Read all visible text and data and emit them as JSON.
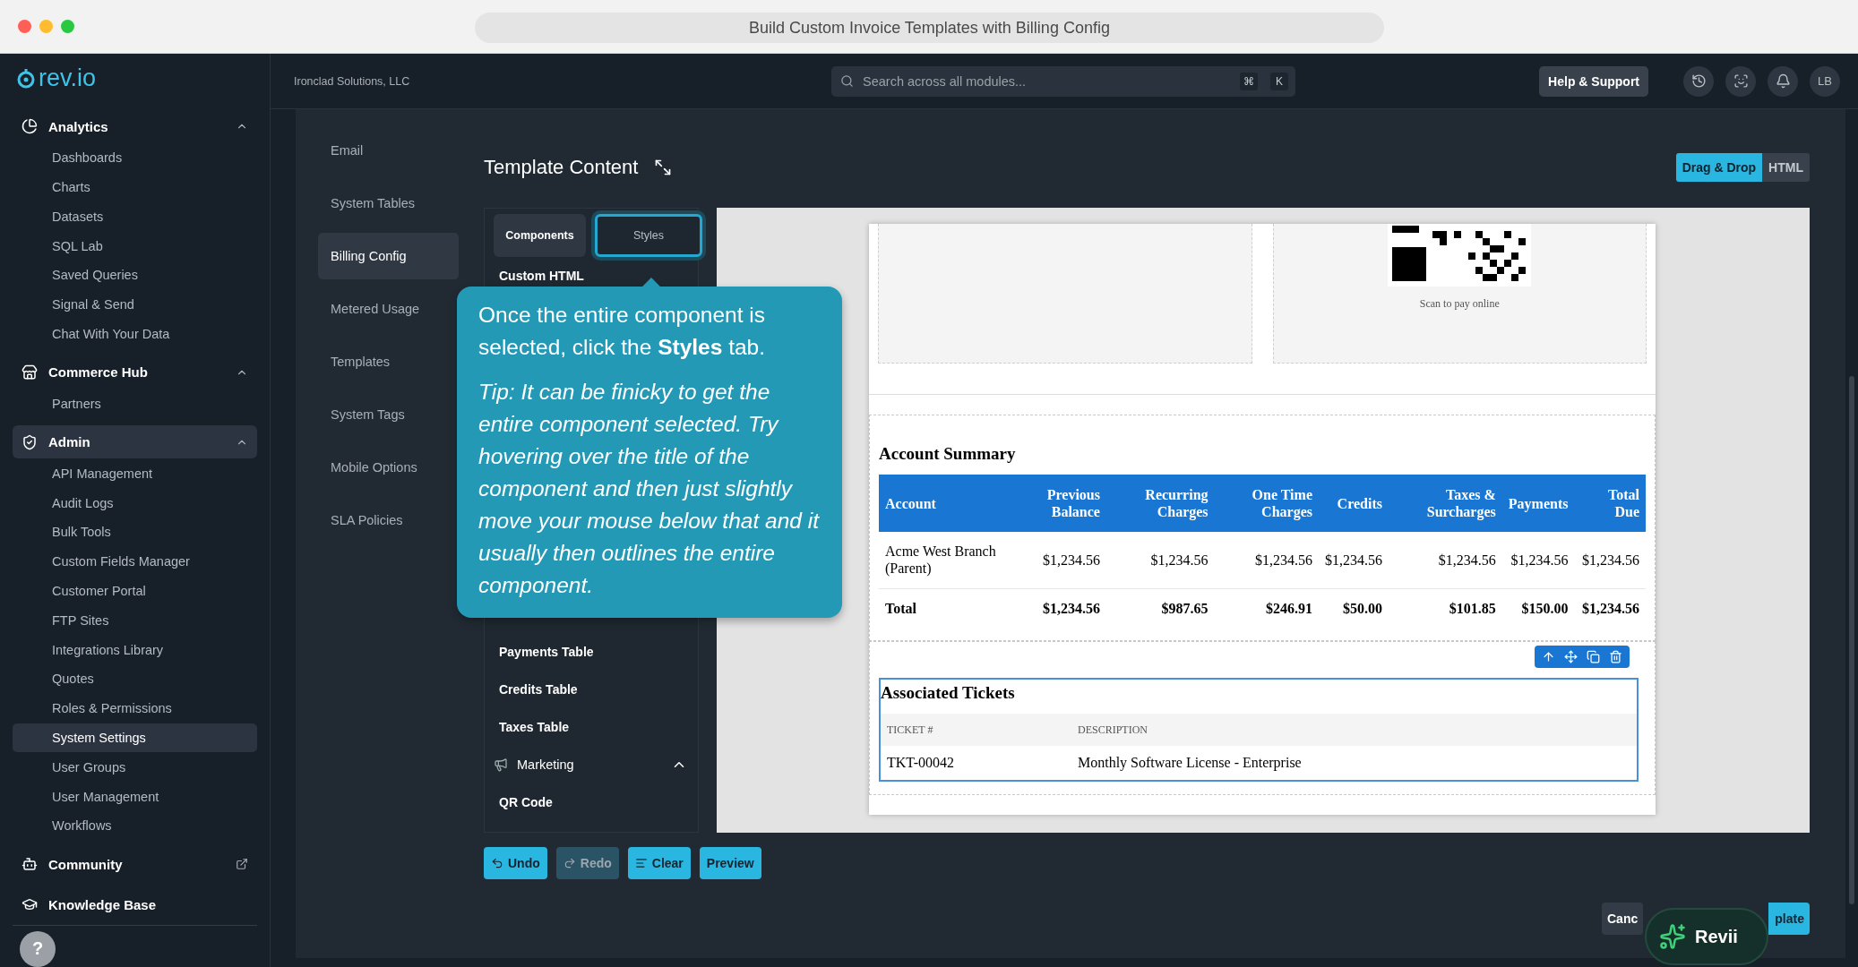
{
  "browser": {
    "title": "Build Custom Invoice Templates with Billing Config"
  },
  "sidebar": {
    "logo": "rev.io",
    "sections": [
      {
        "label": "Analytics",
        "expanded": true,
        "selected": false,
        "items": [
          {
            "label": "Dashboards",
            "selected": false
          },
          {
            "label": "Charts",
            "selected": false
          },
          {
            "label": "Datasets",
            "selected": false
          },
          {
            "label": "SQL Lab",
            "selected": false
          },
          {
            "label": "Saved Queries",
            "selected": false
          },
          {
            "label": "Signal & Send",
            "selected": false
          },
          {
            "label": "Chat With Your Data",
            "selected": false
          }
        ]
      },
      {
        "label": "Commerce Hub",
        "expanded": true,
        "selected": false,
        "items": [
          {
            "label": "Partners",
            "selected": false
          }
        ]
      },
      {
        "label": "Admin",
        "expanded": true,
        "selected": true,
        "items": [
          {
            "label": "API Management",
            "selected": false
          },
          {
            "label": "Audit Logs",
            "selected": false
          },
          {
            "label": "Bulk Tools",
            "selected": false
          },
          {
            "label": "Custom Fields Manager",
            "selected": false
          },
          {
            "label": "Customer Portal",
            "selected": false
          },
          {
            "label": "FTP Sites",
            "selected": false
          },
          {
            "label": "Integrations Library",
            "selected": false
          },
          {
            "label": "Quotes",
            "selected": false
          },
          {
            "label": "Roles & Permissions",
            "selected": false
          },
          {
            "label": "System Settings",
            "selected": true
          },
          {
            "label": "User Groups",
            "selected": false
          },
          {
            "label": "User Management",
            "selected": false
          },
          {
            "label": "Workflows",
            "selected": false
          }
        ]
      }
    ],
    "links": [
      {
        "label": "Community",
        "external": true
      },
      {
        "label": "Knowledge Base",
        "external": false
      }
    ],
    "help": "?"
  },
  "header": {
    "company": "Ironclad Solutions, LLC",
    "search": {
      "placeholder": "Search across all modules...",
      "keys": [
        "⌘",
        "K"
      ]
    },
    "help_button": "Help & Support",
    "avatar": "LB"
  },
  "settings_nav": [
    {
      "label": "Email",
      "selected": false
    },
    {
      "label": "System Tables",
      "selected": false
    },
    {
      "label": "Billing Config",
      "selected": true
    },
    {
      "label": "Metered Usage",
      "selected": false
    },
    {
      "label": "Templates",
      "selected": false
    },
    {
      "label": "System Tags",
      "selected": false
    },
    {
      "label": "Mobile Options",
      "selected": false
    },
    {
      "label": "SLA Policies",
      "selected": false
    }
  ],
  "editor": {
    "title": "Template Content",
    "modes": [
      {
        "label": "Drag & Drop",
        "selected": true
      },
      {
        "label": "HTML",
        "selected": false
      }
    ],
    "panel_tabs": [
      {
        "label": "Components",
        "selected": true,
        "highlighted": false
      },
      {
        "label": "Styles",
        "selected": false,
        "highlighted": true
      }
    ],
    "components": [
      {
        "label": "Custom HTML",
        "kind": "item"
      },
      {
        "label": "Payments Table",
        "kind": "item"
      },
      {
        "label": "Credits Table",
        "kind": "item"
      },
      {
        "label": "Taxes Table",
        "kind": "item"
      },
      {
        "label": "Marketing",
        "kind": "group",
        "expanded": true
      },
      {
        "label": "QR Code",
        "kind": "item"
      }
    ],
    "tooltip": {
      "text": "Once the entire component is selected, click the **Styles** tab.",
      "tip": "Tip: It can be finicky to get the entire component selected. Try hovering over the title of the component and then just slightly move your mouse below that and it usually then outlines the entire component."
    },
    "invoice": {
      "qr_caption": "Scan to pay online",
      "summary": {
        "title": "Account Summary",
        "columns": [
          "Account",
          "Previous Balance",
          "Recurring Charges",
          "One Time Charges",
          "Credits",
          "Taxes & Surcharges",
          "Payments",
          "Total Due"
        ],
        "rows": [
          {
            "kind": "row",
            "cells": [
              "Acme West Branch (Parent)",
              "$1,234.56",
              "$1,234.56",
              "$1,234.56",
              "$1,234.56",
              "$1,234.56",
              "$1,234.56",
              "$1,234.56"
            ]
          },
          {
            "kind": "total",
            "cells": [
              "Total",
              "$1,234.56",
              "$987.65",
              "$246.91",
              "$50.00",
              "$101.85",
              "$150.00",
              "$1,234.56"
            ]
          }
        ]
      },
      "tickets": {
        "title": "Associated Tickets",
        "selected": true,
        "columns": [
          "TICKET #",
          "DESCRIPTION"
        ],
        "rows": [
          [
            "TKT-00042",
            "Monthly Software License - Enterprise"
          ]
        ]
      }
    },
    "actions": [
      {
        "label": "Undo",
        "disabled": false
      },
      {
        "label": "Redo",
        "disabled": true
      },
      {
        "label": "Clear",
        "disabled": false
      },
      {
        "label": "Preview",
        "disabled": false
      }
    ]
  },
  "footer": {
    "cancel": "Canc",
    "save": "plate",
    "assistant": "Revii"
  }
}
